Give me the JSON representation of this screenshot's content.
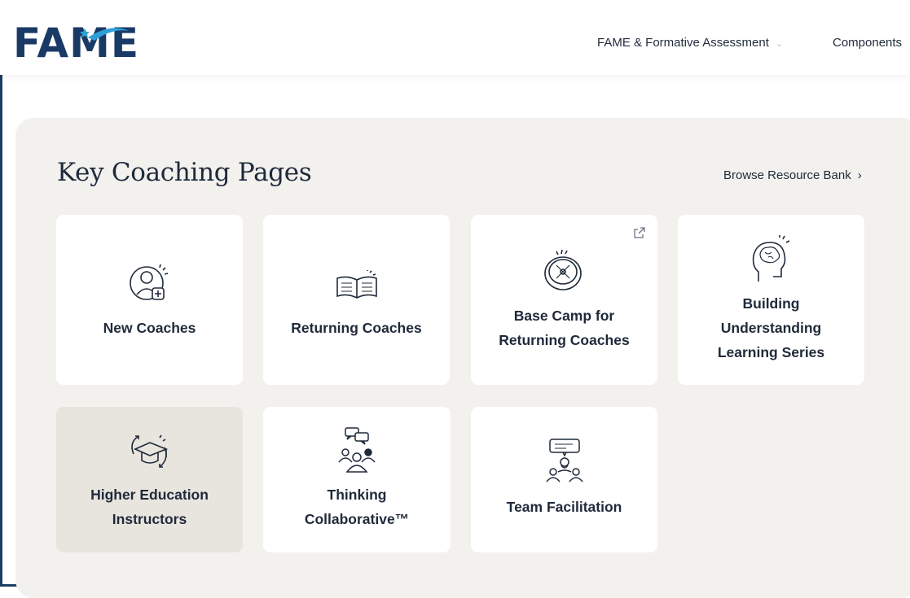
{
  "brand": {
    "logo_text": "FAME",
    "colors": {
      "navy": "#1a3a66",
      "accent": "#2f9fd8",
      "panel": "#f2f1ee",
      "card": "#ffffff",
      "card_active": "#e8e4de"
    }
  },
  "nav": {
    "items": [
      {
        "label": "FAME & Formative Assessment",
        "has_dropdown": true
      },
      {
        "label": "Components"
      }
    ]
  },
  "section": {
    "title": "Key Coaching Pages",
    "browse_link": "Browse Resource Bank",
    "browse_icon": "chevron-right-icon"
  },
  "cards": [
    {
      "label": "New Coaches",
      "icon": "new-coach-icon"
    },
    {
      "label": "Returning Coaches",
      "icon": "open-book-icon"
    },
    {
      "label_line1": "Base Camp for",
      "label_line2": "Returning Coaches",
      "icon": "compass-icon",
      "external": true,
      "external_icon": "external-link-icon"
    },
    {
      "label_line1": "Building",
      "label_line2": "Understanding",
      "label_line3": "Learning Series",
      "icon": "brain-head-icon"
    },
    {
      "label_line1": "Higher Education",
      "label_line2": "Instructors",
      "icon": "graduation-cap-icon",
      "active": true
    },
    {
      "label_line1": "Thinking",
      "label_line2": "Collaborative™",
      "icon": "group-chat-icon"
    },
    {
      "label": "Team Facilitation",
      "icon": "facilitator-icon"
    }
  ]
}
